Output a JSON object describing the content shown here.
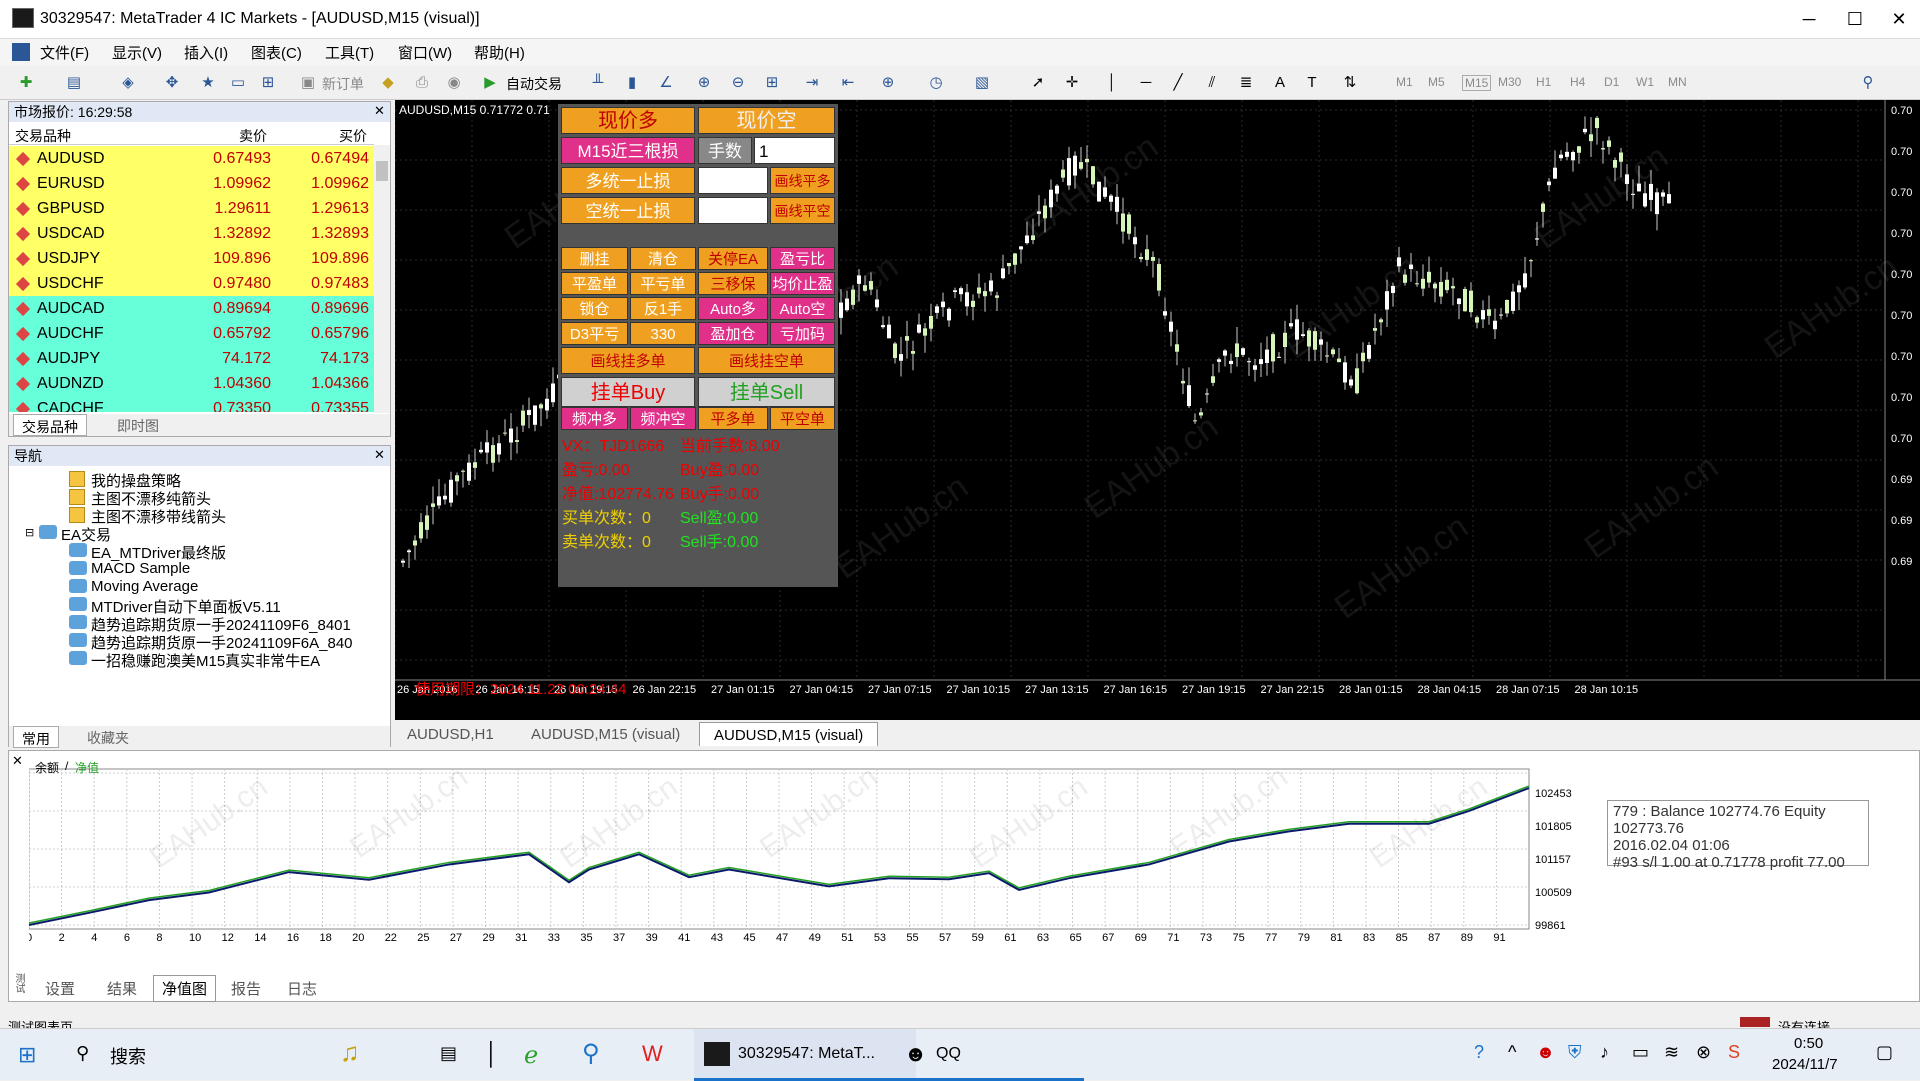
{
  "window": {
    "title": "30329547: MetaTrader 4 IC Markets - [AUDUSD,M15 (visual)]",
    "min": "─",
    "max": "☐",
    "close": "✕"
  },
  "menu": [
    "文件(F)",
    "显示(V)",
    "插入(I)",
    "图表(C)",
    "工具(T)",
    "窗口(W)",
    "帮助(H)"
  ],
  "toolbar": {
    "new_order": "新订单",
    "auto_trade": "自动交易",
    "timeframes": [
      "M1",
      "M5",
      "M15",
      "M30",
      "H1",
      "H4",
      "D1",
      "W1",
      "MN"
    ]
  },
  "market": {
    "title": "市场报价: 16:29:58",
    "col_symbol": "交易品种",
    "col_bid": "卖价",
    "col_ask": "买价",
    "rows": [
      {
        "sym": "AUDUSD",
        "bid": "0.67493",
        "ask": "0.67494",
        "bg": "#ffff66"
      },
      {
        "sym": "EURUSD",
        "bid": "1.09962",
        "ask": "1.09962",
        "bg": "#ffff66"
      },
      {
        "sym": "GBPUSD",
        "bid": "1.29611",
        "ask": "1.29613",
        "bg": "#ffff66"
      },
      {
        "sym": "USDCAD",
        "bid": "1.32892",
        "ask": "1.32893",
        "bg": "#ffff66"
      },
      {
        "sym": "USDJPY",
        "bid": "109.896",
        "ask": "109.896",
        "bg": "#ffff66"
      },
      {
        "sym": "USDCHF",
        "bid": "0.97480",
        "ask": "0.97483",
        "bg": "#ffff66"
      },
      {
        "sym": "AUDCAD",
        "bid": "0.89694",
        "ask": "0.89696",
        "bg": "#66ffd9"
      },
      {
        "sym": "AUDCHF",
        "bid": "0.65792",
        "ask": "0.65796",
        "bg": "#66ffd9"
      },
      {
        "sym": "AUDJPY",
        "bid": "74.172",
        "ask": "74.173",
        "bg": "#66ffd9"
      },
      {
        "sym": "AUDNZD",
        "bid": "1.04360",
        "ask": "1.04366",
        "bg": "#66ffd9"
      },
      {
        "sym": "CADCHF",
        "bid": "0.73350",
        "ask": "0.73355",
        "bg": "#66ffd9"
      }
    ],
    "tabs": [
      "交易品种",
      "即时图"
    ]
  },
  "navigator": {
    "title": "导航",
    "items": [
      "我的操盘策略",
      "主图不漂移纯箭头",
      "主图不漂移带线箭头",
      "EA交易",
      "EA_MTDriver最终版",
      "MACD Sample",
      "Moving Average",
      "MTDriver自动下单面板V5.11",
      "趋势追踪期货原一手20241109F6_8401",
      "趋势追踪期货原一手20241109F6A_840",
      "一招稳赚跑澳美M15真实非常牛EA"
    ],
    "tabs": [
      "常用",
      "收藏夹"
    ]
  },
  "chart": {
    "label": "AUDUSD,M15  0.71772 0.71",
    "expiry": "使用期限：2024.11.22 00:24:44",
    "time_labels": [
      "26 Jan 2016",
      "26 Jan 16:15",
      "26 Jan 19:15",
      "26 Jan 22:15",
      "27 Jan 01:15",
      "27 Jan 04:15",
      "27 Jan 07:15",
      "27 Jan 10:15",
      "27 Jan 13:15",
      "27 Jan 16:15",
      "27 Jan 19:15",
      "27 Jan 22:15",
      "28 Jan 01:15",
      "28 Jan 04:15",
      "28 Jan 07:15",
      "28 Jan 10:15"
    ],
    "price_labels": [
      "0.70",
      "0.70",
      "0.70",
      "0.70",
      "0.70",
      "0.70",
      "0.70",
      "0.70",
      "0.70",
      "0.69",
      "0.69",
      "0.69"
    ],
    "watermark": "EAHub.cn"
  },
  "chart_tabs": [
    "AUDUSD,H1",
    "AUDUSD,M15 (visual)",
    "AUDUSD,M15 (visual)"
  ],
  "panel": {
    "b1": "现价多",
    "b2": "现价空",
    "b3": "M15近三根损",
    "b4": "手数",
    "lots": "1",
    "b5": "多统一止损",
    "b6": "画线平多",
    "b7": "空统一止损",
    "b8": "画线平空",
    "r4": [
      "删挂",
      "清仓",
      "关停EA",
      "盈亏比"
    ],
    "r5": [
      "平盈单",
      "平亏单",
      "三移保",
      "均价止盈"
    ],
    "r6": [
      "锁仓",
      "反1手",
      "Auto多",
      "Auto空"
    ],
    "r7": [
      "D3平亏",
      "330",
      "盈加仓",
      "亏加码"
    ],
    "b9": "画线挂多单",
    "b10": "画线挂空单",
    "r9": [
      "频冲多",
      "频冲空",
      "平多单",
      "平空单"
    ],
    "buy": "挂单Buy",
    "sell": "挂单Sell",
    "info": [
      [
        "VX：TJD1666",
        "当前手数:8.00"
      ],
      [
        "盈亏:0.00",
        "Buy盈:0.00"
      ],
      [
        "净值:102774.76",
        "Buy手:0.00"
      ],
      [
        "买单次数：0",
        "Sell盈:0.00"
      ],
      [
        "卖单次数：0",
        "Sell手:0.00"
      ]
    ]
  },
  "tester": {
    "legend_a": "余额",
    "legend_b": "净值",
    "tooltip": [
      "779 : Balance 102774.76 Equity 102773.76",
      "2016.02.04 01:06",
      "#93 s/l 1.00 at 0.71778 profit 77.00"
    ],
    "y_labels": [
      "102453",
      "101805",
      "101157",
      "100509",
      "99861"
    ],
    "x_labels": [
      "0",
      "2",
      "4",
      "6",
      "8",
      "10",
      "12",
      "14",
      "16",
      "18",
      "20",
      "22",
      "25",
      "27",
      "29",
      "31",
      "33",
      "35",
      "37",
      "39",
      "41",
      "43",
      "45",
      "47",
      "49",
      "51",
      "53",
      "55",
      "57",
      "59",
      "61",
      "63",
      "65",
      "67",
      "69",
      "71",
      "73",
      "75",
      "77",
      "79",
      "81",
      "83",
      "85",
      "87",
      "89",
      "91"
    ],
    "tabs": [
      "设置",
      "结果",
      "净值图",
      "报告",
      "日志"
    ]
  },
  "status": {
    "left": "测试图表页",
    "right": "没有连接"
  },
  "taskbar": {
    "search": "搜索",
    "app1": "30329547: MetaT...",
    "app2": "QQ",
    "time": "0:50",
    "date": "2024/11/7"
  },
  "colors": {
    "bull": "#d6f5b8",
    "bear": "#ffffff",
    "balance": "#0a1a6b",
    "equity": "#22a022",
    "panel_orange": "#f0a020",
    "panel_pink": "#e0308a"
  }
}
